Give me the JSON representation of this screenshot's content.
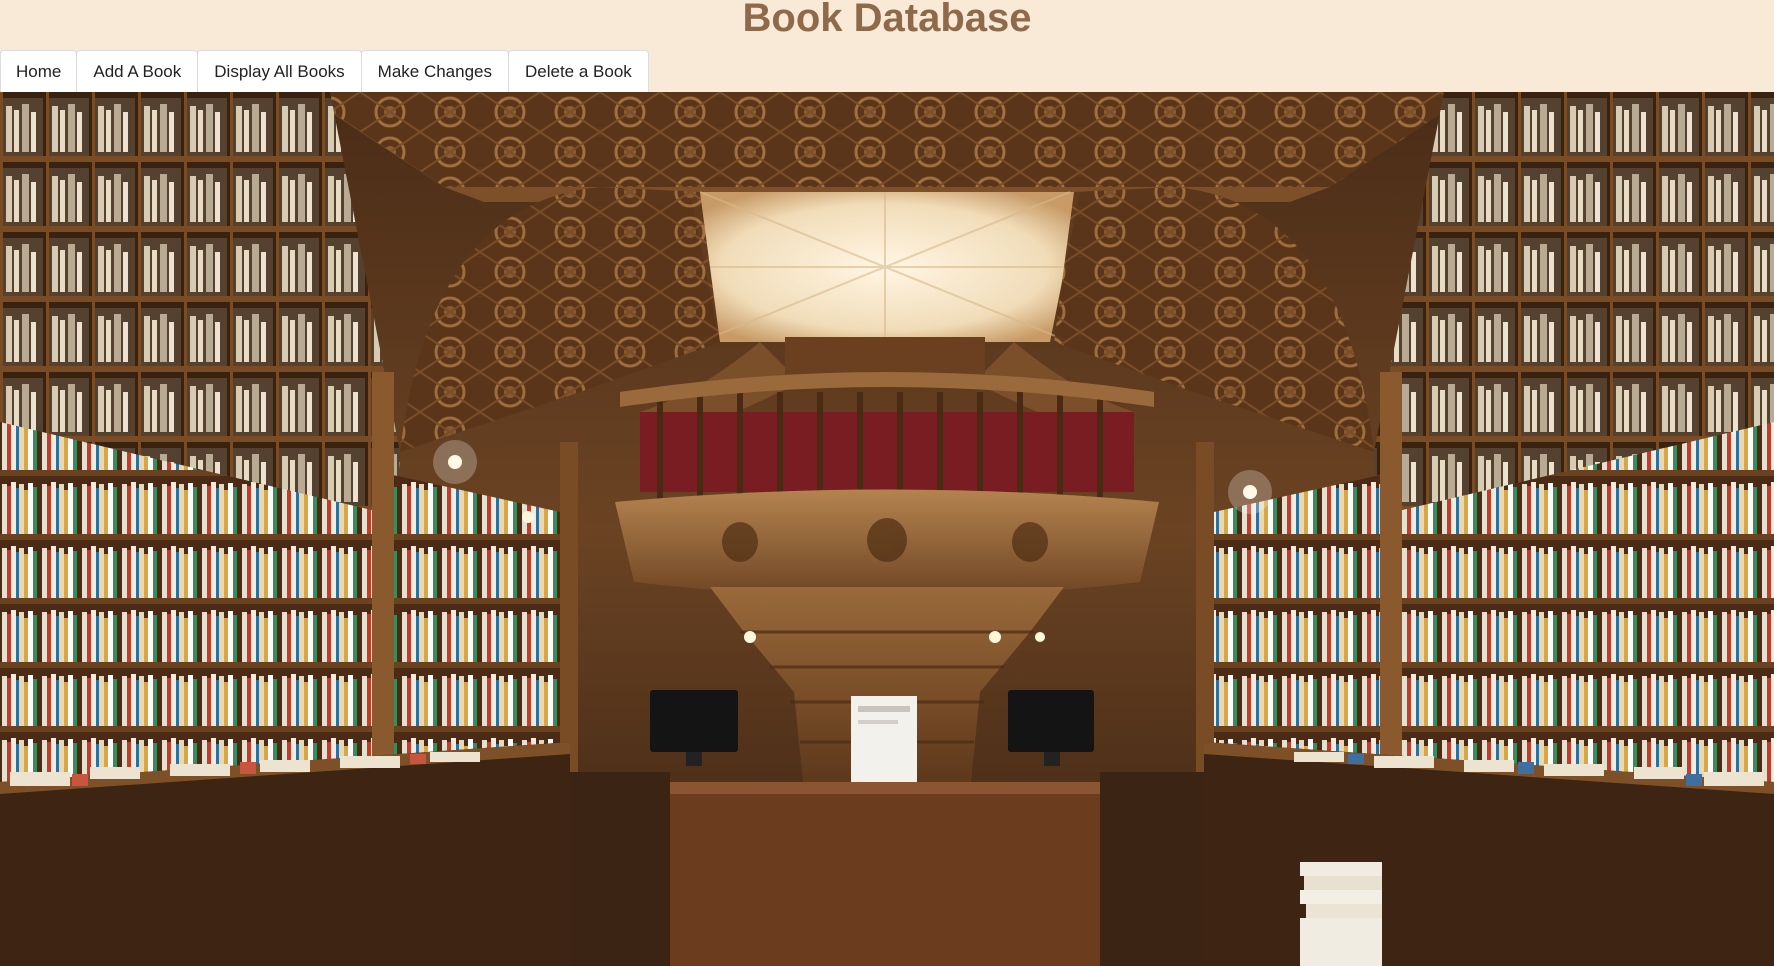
{
  "header": {
    "title": "Book Database"
  },
  "nav": {
    "items": [
      {
        "label": "Home"
      },
      {
        "label": "Add A Book"
      },
      {
        "label": "Display All Books"
      },
      {
        "label": "Make Changes"
      },
      {
        "label": "Delete a Book"
      }
    ]
  },
  "hero": {
    "image": "bookstore-interior-photo"
  },
  "colors": {
    "page_background": "#f8ead6",
    "title": "#8f6a4a",
    "nav_button_bg": "#ffffff",
    "nav_text": "#222222"
  }
}
